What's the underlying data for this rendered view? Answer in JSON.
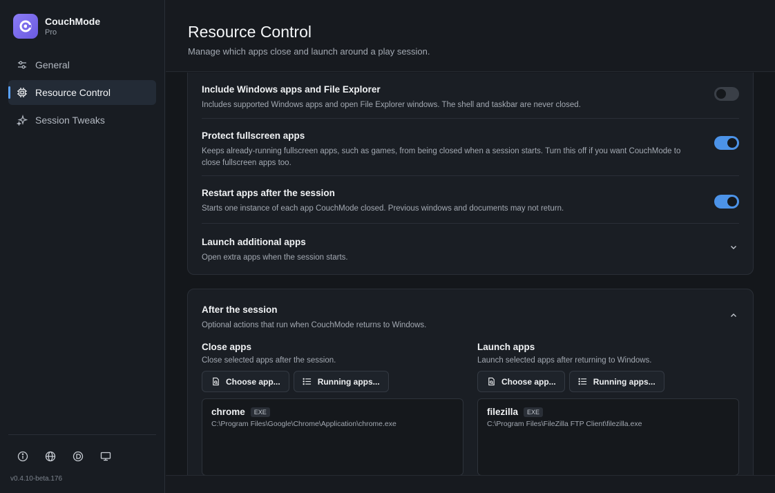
{
  "brand": {
    "name": "CouchMode",
    "tier": "Pro"
  },
  "nav": [
    {
      "label": "General",
      "icon": "sliders-icon"
    },
    {
      "label": "Resource Control",
      "icon": "chip-icon",
      "active": true
    },
    {
      "label": "Session Tweaks",
      "icon": "sparkles-icon"
    }
  ],
  "version": "v0.4.10-beta.176",
  "header": {
    "title": "Resource Control",
    "subtitle": "Manage which apps close and launch around a play session."
  },
  "settings": [
    {
      "title": "Include Windows apps and File Explorer",
      "desc": "Includes supported Windows apps and open File Explorer windows. The shell and taskbar are never closed.",
      "control": "toggle",
      "on": false
    },
    {
      "title": "Protect fullscreen apps",
      "desc": "Keeps already-running fullscreen apps, such as games, from being closed when a session starts. Turn this off if you want CouchMode to close fullscreen apps too.",
      "control": "toggle",
      "on": true
    },
    {
      "title": "Restart apps after the session",
      "desc": "Starts one instance of each app CouchMode closed. Previous windows and documents may not return.",
      "control": "toggle",
      "on": true
    },
    {
      "title": "Launch additional apps",
      "desc": "Open extra apps when the session starts.",
      "control": "chevron-down"
    }
  ],
  "after_session": {
    "title": "After the session",
    "desc": "Optional actions that run when CouchMode returns to Windows.",
    "close_apps": {
      "title": "Close apps",
      "desc": "Close selected apps after the session.",
      "choose_label": "Choose app...",
      "running_label": "Running apps...",
      "app": {
        "name": "chrome",
        "type": "EXE",
        "path": "C:\\Program Files\\Google\\Chrome\\Application\\chrome.exe"
      }
    },
    "launch_apps": {
      "title": "Launch apps",
      "desc": "Launch selected apps after returning to Windows.",
      "choose_label": "Choose app...",
      "running_label": "Running apps...",
      "app": {
        "name": "filezilla",
        "type": "EXE",
        "path": "C:\\Program Files\\FileZilla FTP Client\\filezilla.exe"
      }
    }
  },
  "colors": {
    "accent": "#4c93e8",
    "logo": "#7b6cf0",
    "background": "#14171b"
  }
}
